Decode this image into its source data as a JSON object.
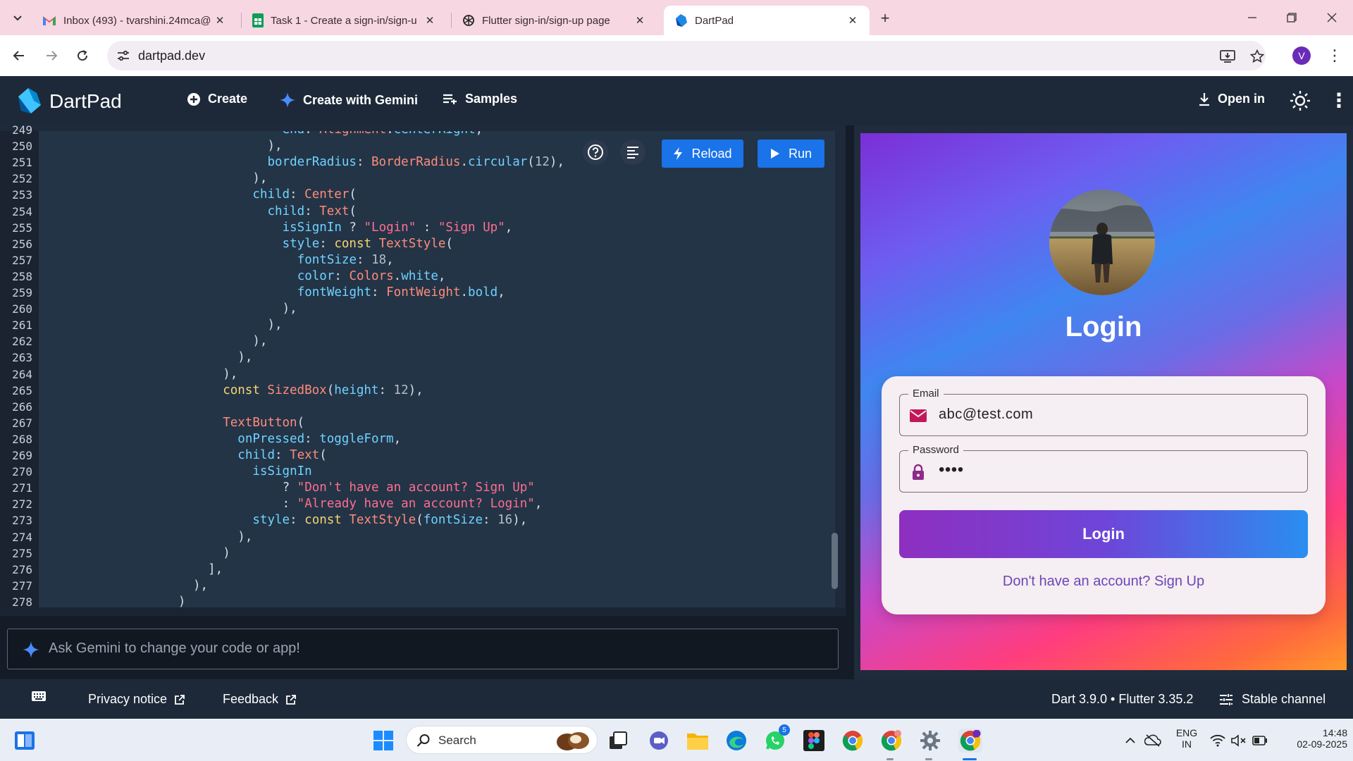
{
  "browser": {
    "tabs": [
      {
        "title": "Inbox (493) - tvarshini.24mca@",
        "icon": "gmail-icon"
      },
      {
        "title": "Task 1 - Create a sign-in/sign-u",
        "icon": "sheets-icon"
      },
      {
        "title": "Flutter sign-in/sign-up page",
        "icon": "chatgpt-icon"
      },
      {
        "title": "DartPad",
        "icon": "dart-icon",
        "active": true
      }
    ],
    "url": "dartpad.dev",
    "profile_initial": "V"
  },
  "header": {
    "title": "DartPad",
    "create_label": "Create",
    "gemini_label": "Create with Gemini",
    "samples_label": "Samples",
    "open_in_label": "Open in"
  },
  "editor": {
    "reload_label": "Reload",
    "run_label": "Run",
    "lines": [
      {
        "n": "249",
        "indent": 16,
        "code": [
          [
            "f",
            "end"
          ],
          [
            "p",
            ": "
          ],
          [
            "t",
            "Alignment"
          ],
          [
            "p",
            "."
          ],
          [
            "f",
            "centerRight"
          ],
          [
            "p",
            ","
          ]
        ]
      },
      {
        "n": "250",
        "indent": 15,
        "code": [
          [
            "p",
            "),"
          ]
        ]
      },
      {
        "n": "251",
        "indent": 15,
        "code": [
          [
            "f",
            "borderRadius"
          ],
          [
            "p",
            ": "
          ],
          [
            "t",
            "BorderRadius"
          ],
          [
            "p",
            "."
          ],
          [
            "f",
            "circular"
          ],
          [
            "p",
            "("
          ],
          [
            "n",
            "12"
          ],
          [
            "p",
            "),"
          ]
        ]
      },
      {
        "n": "252",
        "indent": 14,
        "code": [
          [
            "p",
            "),"
          ]
        ]
      },
      {
        "n": "253",
        "indent": 14,
        "code": [
          [
            "f",
            "child"
          ],
          [
            "p",
            ": "
          ],
          [
            "t",
            "Center"
          ],
          [
            "p",
            "("
          ]
        ]
      },
      {
        "n": "254",
        "indent": 15,
        "code": [
          [
            "f",
            "child"
          ],
          [
            "p",
            ": "
          ],
          [
            "t",
            "Text"
          ],
          [
            "p",
            "("
          ]
        ]
      },
      {
        "n": "255",
        "indent": 16,
        "code": [
          [
            "f",
            "isSignIn"
          ],
          [
            "p",
            " ? "
          ],
          [
            "s",
            "\"Login\""
          ],
          [
            "p",
            " : "
          ],
          [
            "s",
            "\"Sign Up\""
          ],
          [
            "p",
            ","
          ]
        ]
      },
      {
        "n": "256",
        "indent": 16,
        "code": [
          [
            "f",
            "style"
          ],
          [
            "p",
            ": "
          ],
          [
            "k",
            "const "
          ],
          [
            "t",
            "TextStyle"
          ],
          [
            "p",
            "("
          ]
        ]
      },
      {
        "n": "257",
        "indent": 17,
        "code": [
          [
            "f",
            "fontSize"
          ],
          [
            "p",
            ": "
          ],
          [
            "n",
            "18"
          ],
          [
            "p",
            ","
          ]
        ]
      },
      {
        "n": "258",
        "indent": 17,
        "code": [
          [
            "f",
            "color"
          ],
          [
            "p",
            ": "
          ],
          [
            "t",
            "Colors"
          ],
          [
            "p",
            "."
          ],
          [
            "f",
            "white"
          ],
          [
            "p",
            ","
          ]
        ]
      },
      {
        "n": "259",
        "indent": 17,
        "code": [
          [
            "f",
            "fontWeight"
          ],
          [
            "p",
            ": "
          ],
          [
            "t",
            "FontWeight"
          ],
          [
            "p",
            "."
          ],
          [
            "f",
            "bold"
          ],
          [
            "p",
            ","
          ]
        ]
      },
      {
        "n": "260",
        "indent": 16,
        "code": [
          [
            "p",
            "),"
          ]
        ]
      },
      {
        "n": "261",
        "indent": 15,
        "code": [
          [
            "p",
            "),"
          ]
        ]
      },
      {
        "n": "262",
        "indent": 14,
        "code": [
          [
            "p",
            "),"
          ]
        ]
      },
      {
        "n": "263",
        "indent": 13,
        "code": [
          [
            "p",
            "),"
          ]
        ]
      },
      {
        "n": "264",
        "indent": 12,
        "code": [
          [
            "p",
            "),"
          ]
        ]
      },
      {
        "n": "265",
        "indent": 12,
        "code": [
          [
            "k",
            "const "
          ],
          [
            "t",
            "SizedBox"
          ],
          [
            "p",
            "("
          ],
          [
            "f",
            "height"
          ],
          [
            "p",
            ": "
          ],
          [
            "n",
            "12"
          ],
          [
            "p",
            "),"
          ]
        ]
      },
      {
        "n": "266",
        "indent": 0,
        "code": []
      },
      {
        "n": "267",
        "indent": 12,
        "code": [
          [
            "t",
            "TextButton"
          ],
          [
            "p",
            "("
          ]
        ]
      },
      {
        "n": "268",
        "indent": 13,
        "code": [
          [
            "f",
            "onPressed"
          ],
          [
            "p",
            ": "
          ],
          [
            "f",
            "toggleForm"
          ],
          [
            "p",
            ","
          ]
        ]
      },
      {
        "n": "269",
        "indent": 13,
        "code": [
          [
            "f",
            "child"
          ],
          [
            "p",
            ": "
          ],
          [
            "t",
            "Text"
          ],
          [
            "p",
            "("
          ]
        ]
      },
      {
        "n": "270",
        "indent": 14,
        "code": [
          [
            "f",
            "isSignIn"
          ]
        ]
      },
      {
        "n": "271",
        "indent": 16,
        "code": [
          [
            "p",
            "? "
          ],
          [
            "s",
            "\"Don't have an account? Sign Up\""
          ]
        ]
      },
      {
        "n": "272",
        "indent": 16,
        "code": [
          [
            "p",
            ": "
          ],
          [
            "s",
            "\"Already have an account? Login\""
          ],
          [
            "p",
            ","
          ]
        ]
      },
      {
        "n": "273",
        "indent": 14,
        "code": [
          [
            "f",
            "style"
          ],
          [
            "p",
            ": "
          ],
          [
            "k",
            "const "
          ],
          [
            "t",
            "TextStyle"
          ],
          [
            "p",
            "("
          ],
          [
            "f",
            "fontSize"
          ],
          [
            "p",
            ": "
          ],
          [
            "n",
            "16"
          ],
          [
            "p",
            "),"
          ]
        ]
      },
      {
        "n": "274",
        "indent": 13,
        "code": [
          [
            "p",
            "),"
          ]
        ]
      },
      {
        "n": "275",
        "indent": 12,
        "code": [
          [
            "p",
            ")"
          ]
        ]
      },
      {
        "n": "276",
        "indent": 11,
        "code": [
          [
            "p",
            "],"
          ]
        ]
      },
      {
        "n": "277",
        "indent": 10,
        "code": [
          [
            "p",
            "),"
          ]
        ]
      },
      {
        "n": "278",
        "indent": 9,
        "code": [
          [
            "p",
            ")"
          ]
        ]
      }
    ]
  },
  "prompt": {
    "placeholder": "Ask Gemini to change your code or app!"
  },
  "preview": {
    "title": "Login",
    "email_label": "Email",
    "email_value": "abc@test.com",
    "password_label": "Password",
    "password_value": "••••",
    "login_button": "Login",
    "signup_link": "Don't have an account? Sign Up"
  },
  "footer": {
    "privacy": "Privacy notice",
    "feedback": "Feedback",
    "version": "Dart 3.9.0 • Flutter 3.35.2",
    "channel": "Stable channel"
  },
  "taskbar": {
    "search_label": "Search",
    "whatsapp_badge": "5",
    "lang_line1": "ENG",
    "lang_line2": "IN",
    "time": "14:48",
    "date": "02-09-2025"
  },
  "colors": {
    "accent": "#1a73e8",
    "header_bg": "#1d2939",
    "editor_bg": "#233447"
  }
}
